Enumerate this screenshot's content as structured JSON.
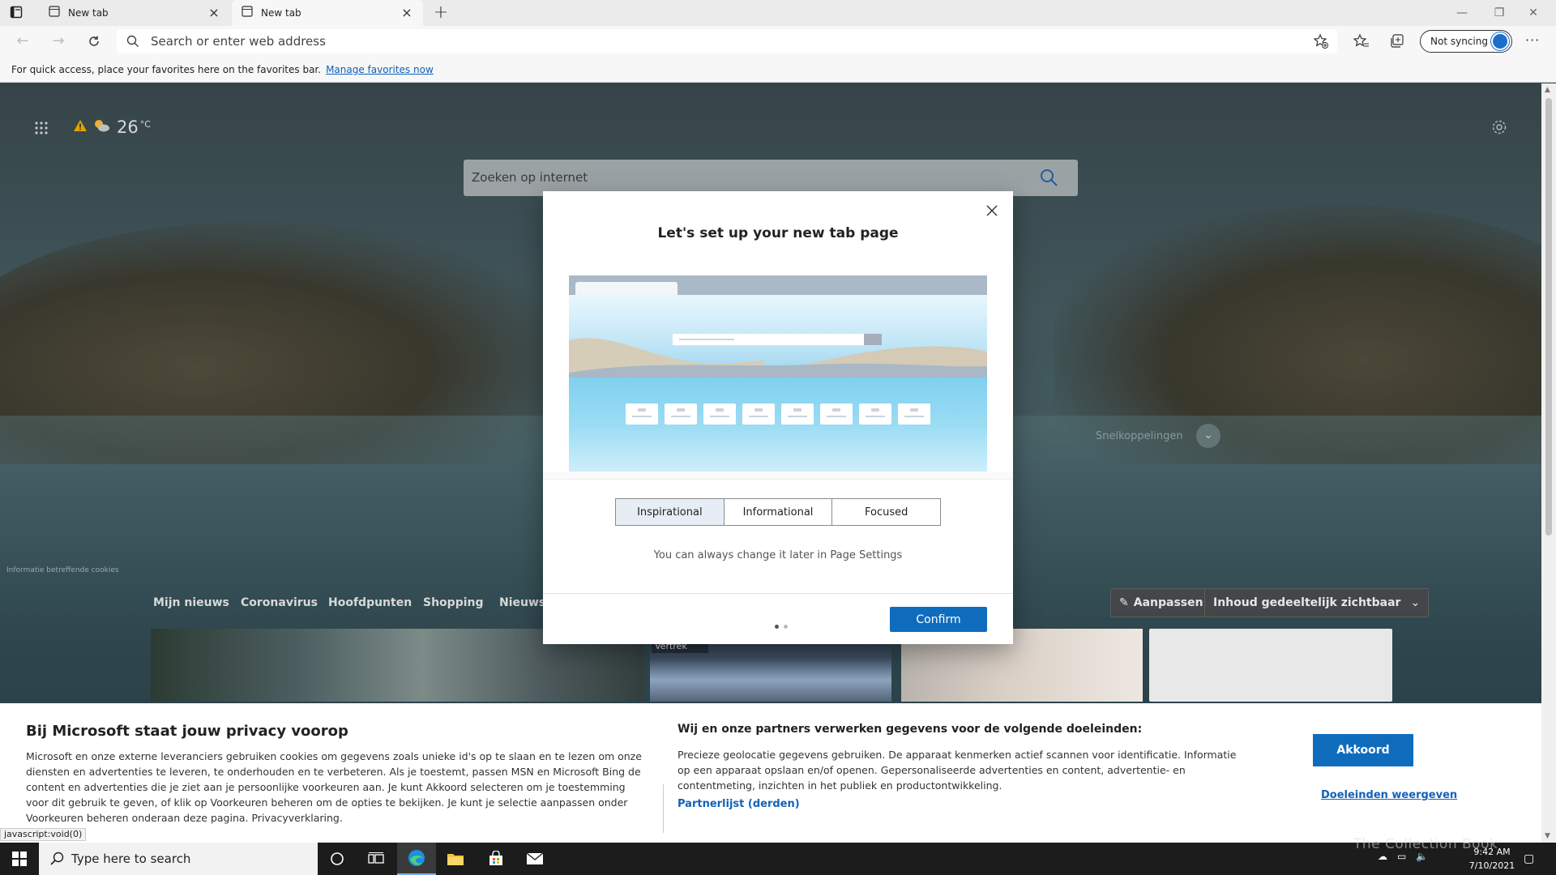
{
  "tabs": [
    {
      "label": "New tab"
    },
    {
      "label": "New tab"
    }
  ],
  "addressbar": {
    "placeholder": "Search or enter web address"
  },
  "profile": {
    "sync_label": "Not syncing"
  },
  "favbar": {
    "text": "For quick access, place your favorites here on the favorites bar.",
    "link": "Manage favorites now"
  },
  "ntp": {
    "weather": {
      "temp": "26",
      "unit": "°C"
    },
    "search_placeholder": "Zoeken op internet",
    "quicklinks_label": "Snelkoppelingen",
    "cookie_note": "Informatie betreffende cookies",
    "news_tabs": [
      "Mijn nieuws",
      "Coronavirus",
      "Hoofdpunten",
      "Shopping",
      "Nieuws"
    ],
    "customize_label": "Aanpassen",
    "visibility_label": "Inhoud gedeeltelijk zichtbaar",
    "card_caption": "Departures\nVertrek"
  },
  "modal": {
    "title": "Let's set up your new tab page",
    "options": [
      "Inspirational",
      "Informational",
      "Focused"
    ],
    "selected": "Inspirational",
    "hint": "You can always change it later in Page Settings",
    "confirm_label": "Confirm",
    "page_indicator": {
      "current": 1,
      "total": 2
    }
  },
  "cookie_banner": {
    "title": "Bij Microsoft staat jouw privacy voorop",
    "body": "Microsoft en onze externe leveranciers gebruiken cookies om gegevens zoals unieke id's op te slaan en te lezen om onze diensten en advertenties te leveren, te onderhouden en te verbeteren. Als je toestemt, passen MSN en Microsoft Bing de content en advertenties die je ziet aan je persoonlijke voorkeuren aan. Je kunt Akkoord selecteren om je toestemming voor dit gebruik te geven, of klik op Voorkeuren beheren om de opties te bekijken. Je kunt je selectie aanpassen onder Voorkeuren beheren onderaan deze pagina. Privacyverklaring.",
    "purposes_title": "Wij en onze partners verwerken gegevens voor de volgende doeleinden:",
    "purposes_body": "Precieze geolocatie gegevens gebruiken. De apparaat kenmerken actief scannen voor identificatie. Informatie op een apparaat opslaan en/of openen. Gepersonaliseerde advertenties en content, advertentie- en contentmeting, inzichten in het publiek en productontwikkeling.",
    "partner_link": "Partnerlijst (derden)",
    "accept_label": "Akkoord",
    "purposes_link": "Doeleinden weergeven"
  },
  "status_url": "javascript:void(0)",
  "taskbar": {
    "search_placeholder": "Type here to search",
    "time": "9:42 AM",
    "date": "7/10/2021"
  },
  "watermark": "The Collection Book",
  "colors": {
    "accent": "#0f6cbd",
    "link": "#1361b9"
  }
}
